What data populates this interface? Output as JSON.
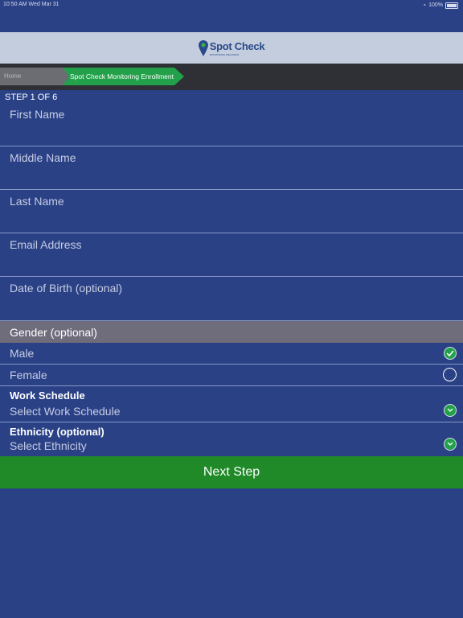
{
  "status_bar": {
    "time": "10:50 AM  Wed Mar 31",
    "battery": "100%"
  },
  "header": {
    "brand": "Spot Check",
    "tagline": "MONITORING WELLNESS"
  },
  "breadcrumb": {
    "home": "Home",
    "current": "Spot Check Monitoring Enrollment"
  },
  "step_label": "STEP 1 OF 6",
  "fields": {
    "first_name": "First Name",
    "middle_name": "Middle Name",
    "last_name": "Last Name",
    "email": "Email Address",
    "dob": "Date of Birth (optional)"
  },
  "gender": {
    "heading": "Gender (optional)",
    "options": [
      {
        "label": "Male",
        "selected": true
      },
      {
        "label": "Female",
        "selected": false
      }
    ]
  },
  "work_schedule": {
    "title": "Work Schedule",
    "placeholder": "Select Work Schedule"
  },
  "ethnicity": {
    "title": "Ethnicity (optional)",
    "placeholder": "Select Ethnicity"
  },
  "next_button": "Next Step",
  "colors": {
    "background": "#2a4186",
    "header": "#c3cddd",
    "breadcrumb_active": "#22a04a",
    "section_header": "#6f6c7c",
    "primary_button": "#1f8a27"
  }
}
